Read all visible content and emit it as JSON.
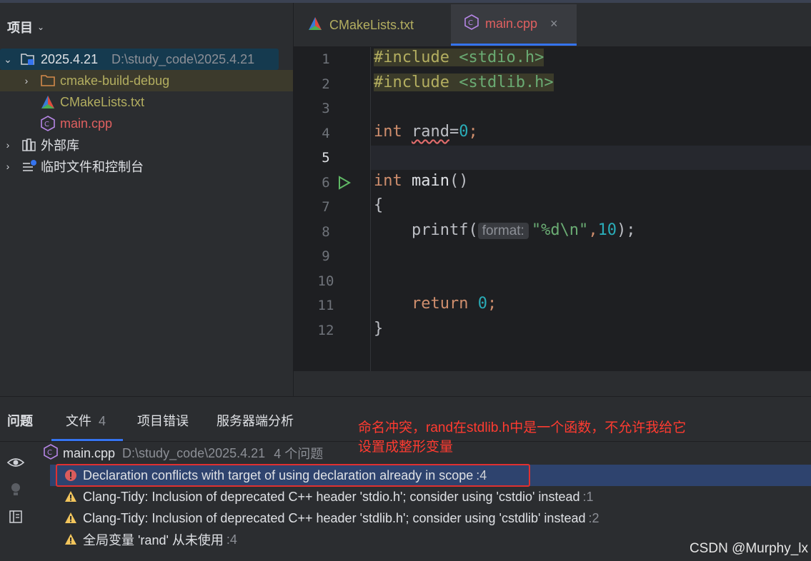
{
  "project_panel": {
    "title": "项目",
    "root_name": "2025.4.21",
    "root_path": "D:\\study_code\\2025.4.21",
    "items": [
      {
        "label": "cmake-build-debug"
      },
      {
        "label": "CMakeLists.txt"
      },
      {
        "label": "main.cpp"
      }
    ],
    "external_libs": "外部库",
    "scratches": "临时文件和控制台"
  },
  "tabs": [
    {
      "label": "CMakeLists.txt"
    },
    {
      "label": "main.cpp"
    }
  ],
  "editor": {
    "line_numbers": [
      "1",
      "2",
      "3",
      "4",
      "5",
      "6",
      "7",
      "8",
      "9",
      "10",
      "11",
      "12"
    ],
    "inc1_kw": "#include",
    "inc1_file": "<stdio.h>",
    "inc2_kw": "#include",
    "inc2_file": "<stdlib.h>",
    "l4_type": "int",
    "l4_var": "rand",
    "l4_eq": "=",
    "l4_val": "0",
    "l4_semi": ";",
    "l6_type": "int",
    "l6_name": "main",
    "l6_parens": "()",
    "l7": "{",
    "l8_fn": "printf(",
    "l8_hint": "format:",
    "l8_str": "\"%d\\n\"",
    "l8_comma": ",",
    "l8_num": "10",
    "l8_end": ");",
    "l11_kw": "return",
    "l11_val": "0",
    "l11_semi": ";",
    "l12": "}"
  },
  "problems": {
    "tab_title": "问题",
    "tab_file": "文件",
    "tab_file_count": "4",
    "tab_project_errors": "项目错误",
    "tab_server_analysis": "服务器端分析",
    "file_name": "main.cpp",
    "file_path": "D:\\study_code\\2025.4.21",
    "file_count": "4 个问题",
    "items": [
      {
        "text": "Declaration conflicts with target of using declaration already in scope",
        "loc": ":4",
        "severity": "error"
      },
      {
        "text": "Clang-Tidy: Inclusion of deprecated C++ header 'stdio.h'; consider using 'cstdio' instead",
        "loc": ":1",
        "severity": "warning"
      },
      {
        "text": "Clang-Tidy: Inclusion of deprecated C++ header 'stdlib.h'; consider using 'cstdlib' instead",
        "loc": ":2",
        "severity": "warning"
      },
      {
        "text": "全局变量 'rand' 从未使用",
        "loc": ":4",
        "severity": "warning"
      }
    ]
  },
  "annotation": {
    "line1": "命名冲突，rand在stdlib.h中是一个函数，不允许我给它",
    "line2": "设置成整形变量"
  },
  "watermark": "CSDN @Murphy_lx",
  "colors": {
    "accent": "#3574f0",
    "error": "#db5c5c",
    "warning": "#f2c55c",
    "annotation": "#ff3b30"
  }
}
